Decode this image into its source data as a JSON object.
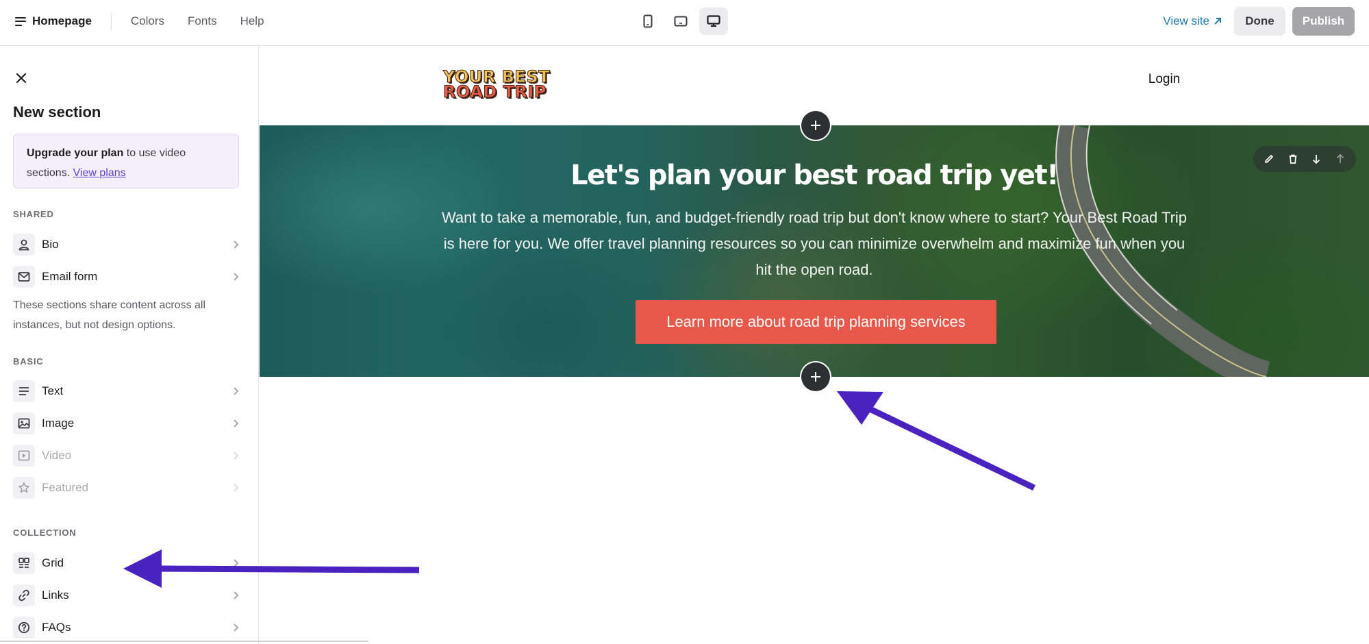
{
  "topbar": {
    "page_name": "Homepage",
    "links": [
      "Colors",
      "Fonts",
      "Help"
    ],
    "view_site": "View site",
    "done": "Done",
    "publish": "Publish"
  },
  "sidebar": {
    "title": "New section",
    "upgrade": {
      "bold": "Upgrade your plan",
      "text": " to use video sections. ",
      "link": "View plans"
    },
    "shared_label": "SHARED",
    "shared_items": [
      "Bio",
      "Email form"
    ],
    "shared_note": "These sections share content across all instances, but not design options.",
    "basic_label": "BASIC",
    "basic_items": [
      "Text",
      "Image",
      "Video",
      "Featured"
    ],
    "collection_label": "COLLECTION",
    "collection_items": [
      "Grid",
      "Links",
      "FAQs"
    ]
  },
  "site": {
    "logo_line1": "YOUR BEST",
    "logo_line2": "ROAD TRIP",
    "login": "Login",
    "hero_title": "Let's plan your best road trip yet!",
    "hero_body": "Want to take a memorable, fun, and budget-friendly road trip but don't know where to start? Your Best Road Trip is here for you. We offer travel planning resources so you can minimize overwhelm and maximize fun when you hit the open road.",
    "hero_cta": "Learn more about road trip planning services"
  },
  "colors": {
    "accent": "#1f7ab0",
    "cta": "#e8584a",
    "annotation_arrow": "#4a22c0",
    "upgrade_bg": "#f3f0fb"
  }
}
